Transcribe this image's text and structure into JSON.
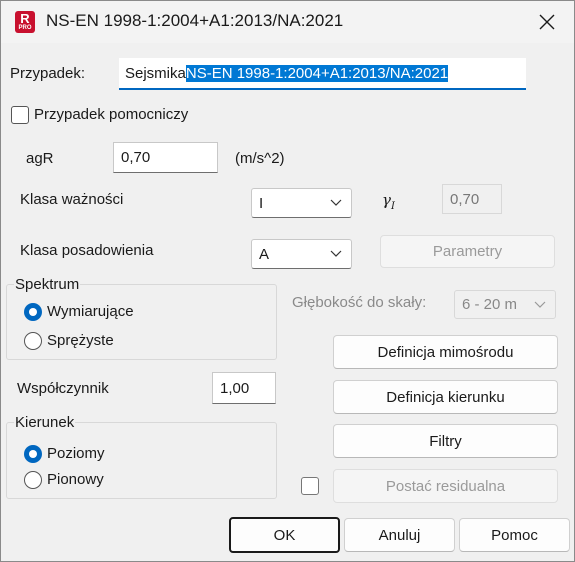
{
  "window": {
    "title": "NS-EN 1998-1:2004+A1:2013/NA:2021"
  },
  "app_icon": {
    "letter": "R",
    "badge": "PRO",
    "color": "#c8102e"
  },
  "przypadek": {
    "label": "Przypadek:",
    "value_plain": "Sejsmika",
    "value_selected": "NS-EN 1998-1:2004+A1:2013/NA:2021"
  },
  "pomocniczy": {
    "label": "Przypadek pomocniczy",
    "checked": false
  },
  "agr": {
    "label": "agR",
    "value": "0,70",
    "unit": "(m/s^2)"
  },
  "klasa_waznosci": {
    "label": "Klasa ważności",
    "value": "I"
  },
  "gamma": {
    "symbol": "γ",
    "subscript": "I",
    "value": "0,70"
  },
  "klasa_posadowienia": {
    "label": "Klasa posadowienia",
    "value": "A"
  },
  "parametry_button": {
    "label": "Parametry"
  },
  "spektrum": {
    "title": "Spektrum",
    "options": [
      "Wymiarujące",
      "Sprężyste"
    ],
    "selected": "Wymiarujące"
  },
  "glebokosc": {
    "label": "Głębokość do skały:",
    "value": "6 - 20 m"
  },
  "wspolczynnik": {
    "label": "Współczynnik",
    "value": "1,00"
  },
  "kierunek": {
    "title": "Kierunek",
    "options": [
      "Poziomy",
      "Pionowy"
    ],
    "selected": "Poziomy"
  },
  "buttons": {
    "definicja_mimosrodu": "Definicja mimośrodu",
    "definicja_kierunku": "Definicja kierunku",
    "filtry": "Filtry",
    "postac_residualna": "Postać residualna",
    "ok": "OK",
    "anuluj": "Anuluj",
    "pomoc": "Pomoc"
  },
  "colors": {
    "accent": "#0067c0",
    "selection": "#0078d4"
  }
}
